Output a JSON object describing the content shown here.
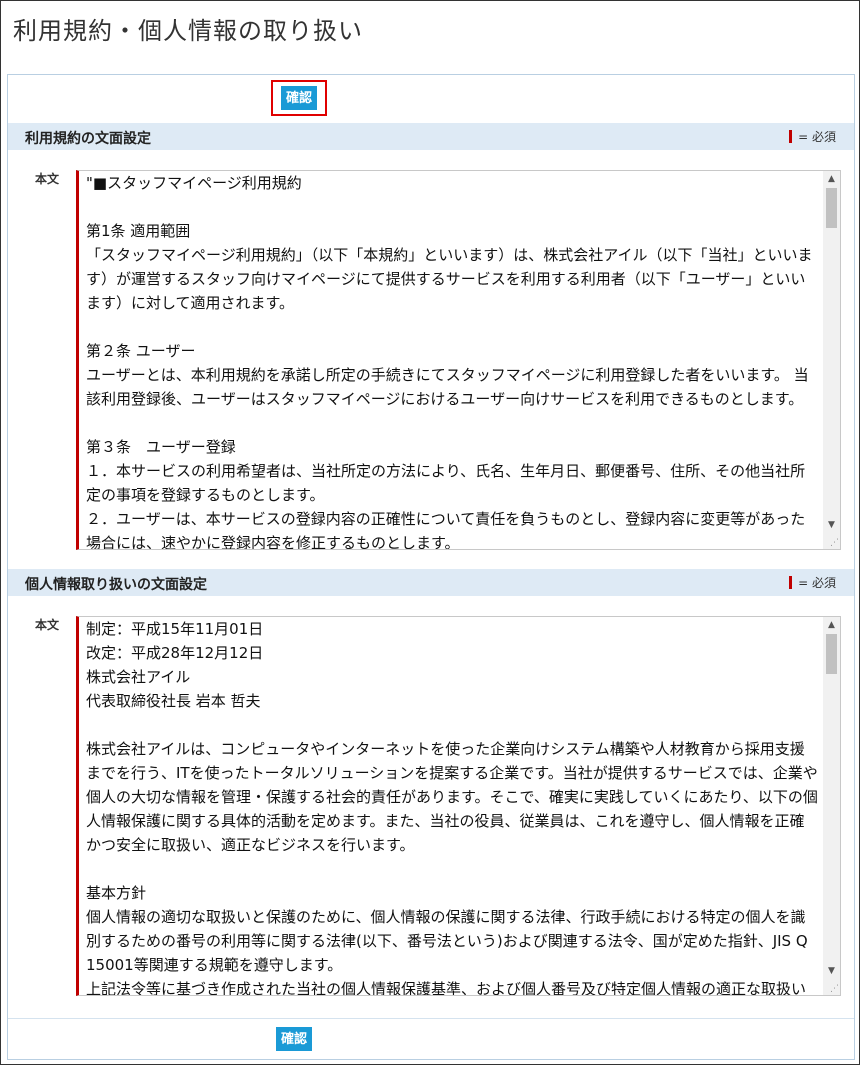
{
  "page": {
    "title": "利用規約・個人情報の取り扱い"
  },
  "actions": {
    "confirm_label": "確認"
  },
  "required_legend": "= 必須",
  "sections": [
    {
      "title": "利用規約の文面設定",
      "field_label": "本文",
      "body": "\"■スタッフマイページ利用規約\n\n第1条 適用範囲\n「スタッフマイページ利用規約」（以下「本規約」といいます）は、株式会社アイル（以下「当社」といいます）が運営するスタッフ向けマイページにて提供するサービスを利用する利用者（以下「ユーザー」といいます）に対して適用されます。\n\n第２条 ユーザー\nユーザーとは、本利用規約を承諾し所定の手続きにてスタッフマイページに利用登録した者をいいます。 当該利用登録後、ユーザーはスタッフマイページにおけるユーザー向けサービスを利用できるものとします。\n\n第３条　ユーザー登録\n１．本サービスの利用希望者は、当社所定の方法により、氏名、生年月日、郵便番号、住所、その他当社所定の事項を登録するものとします。\n２．ユーザーは、本サービスの登録内容の正確性について責任を負うものとし、登録内容に変更等があった場合には、速やかに登録内容を修正するものとします。"
    },
    {
      "title": "個人情報取り扱いの文面設定",
      "field_label": "本文",
      "body": "制定：平成15年11月01日\n改定：平成28年12月12日\n株式会社アイル\n代表取締役社長 岩本 哲夫\n\n株式会社アイルは、コンピュータやインターネットを使った企業向けシステム構築や人材教育から採用支援までを行う、ITを使ったトータルソリューションを提案する企業です。当社が提供するサービスでは、企業や個人の大切な情報を管理・保護する社会的責任があります。そこで、確実に実践していくにあたり、以下の個人情報保護に関する具体的活動を定めます。また、当社の役員、従業員は、これを遵守し、個人情報を正確かつ安全に取扱い、適正なビジネスを行います。\n\n基本方針\n個人情報の適切な取扱いと保護のために、個人情報の保護に関する法律、行政手続における特定の個人を識別するための番号の利用等に関する法律(以下、番号法という)および関連する法令、国が定めた指針、JIS Q 15001等関連する規範を遵守します。\n上記法令等に基づき作成された当社の個人情報保護基準、および個人番号及び特定個人情報の適正な取扱いに関する基本方針を定め、個人情報保護マネジメントシステムを策定し、確実に実行します。"
    }
  ]
}
